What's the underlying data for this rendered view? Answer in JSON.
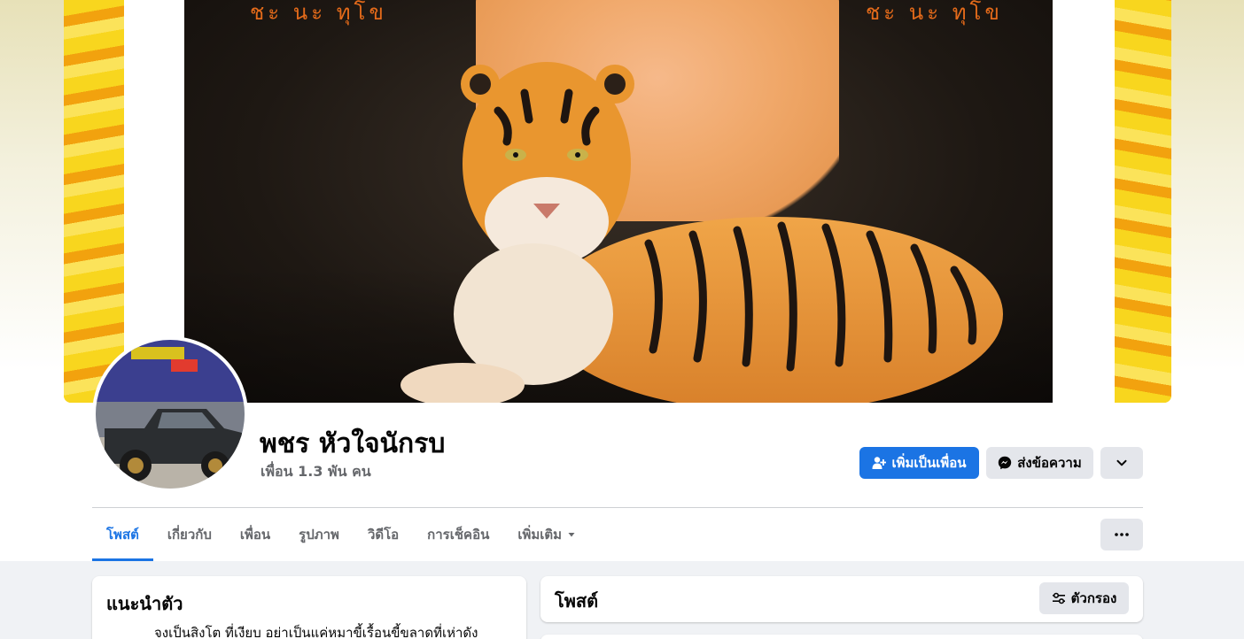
{
  "profile": {
    "name": "พชร หัวใจนักรบ",
    "friends_count": "เพื่อน 1.3 พัน คน"
  },
  "cover": {
    "top_text_left": "ชะ นะ ทุโข",
    "top_text_right": "ชะ นะ ทุโข"
  },
  "actions": {
    "add_friend_label": "เพิ่มเป็นเพื่อน",
    "message_label": "ส่งข้อความ",
    "add_friend_icon": "person-add-icon",
    "message_icon": "messenger-icon",
    "more_icon": "chevron-down-icon"
  },
  "tabs": [
    {
      "label": "โพสต์",
      "active": true
    },
    {
      "label": "เกี่ยวกับ",
      "active": false
    },
    {
      "label": "เพื่อน",
      "active": false
    },
    {
      "label": "รูปภาพ",
      "active": false
    },
    {
      "label": "วิดีโอ",
      "active": false
    },
    {
      "label": "การเช็คอิน",
      "active": false
    },
    {
      "label": "เพิ่มเติม",
      "active": false
    }
  ],
  "intro": {
    "title": "แนะนำตัว",
    "bio": "จงเป็นสิงโต ที่เงียบ อย่าเป็นแค่หมาขี้เรื้อนขี้ขลาดที่เห่าดัง"
  },
  "posts": {
    "title": "โพสต์",
    "filter_label": "ตัวกรอง"
  },
  "colors": {
    "accent": "#1b74e4",
    "button_gray": "#e4e6eb",
    "secondary_text": "#65676b",
    "page_bg": "#f0f2f5"
  }
}
